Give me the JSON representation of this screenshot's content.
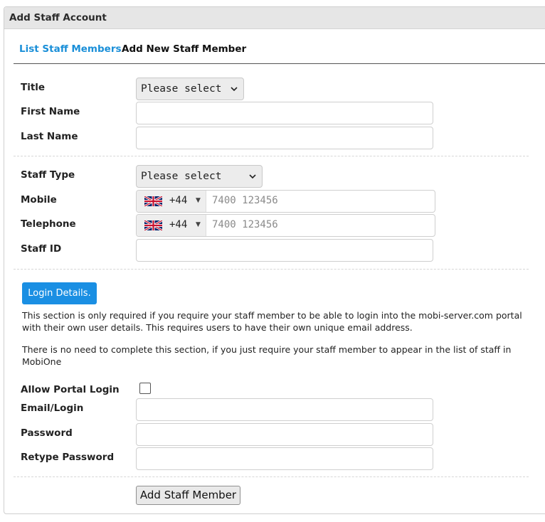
{
  "panel": {
    "title": "Add Staff Account"
  },
  "tabs": [
    {
      "label": "List Staff Members"
    },
    {
      "label": "Add New Staff Member"
    }
  ],
  "form": {
    "title_label": "Title",
    "title_select": "Please select",
    "first_name_label": "First Name",
    "first_name_value": "",
    "last_name_label": "Last Name",
    "last_name_value": "",
    "staff_type_label": "Staff Type",
    "staff_type_select": "Please select",
    "mobile_label": "Mobile",
    "mobile_country_code": "+44",
    "mobile_placeholder": "7400 123456",
    "telephone_label": "Telephone",
    "telephone_country_code": "+44",
    "telephone_placeholder": "7400 123456",
    "staff_id_label": "Staff ID",
    "staff_id_value": ""
  },
  "login": {
    "button_label": "Login Details.",
    "paragraph1": "This section is only required if you require your staff member to be able to login into the mobi-server.com portal with their own user details. This requires users to have their own unique email address.",
    "paragraph2": "There is no need to complete this section, if you just require your staff member to appear in the list of staff in MobiOne",
    "allow_portal_label": "Allow Portal Login",
    "allow_portal_checked": false,
    "email_label": "Email/Login",
    "password_label": "Password",
    "retype_password_label": "Retype Password"
  },
  "submit_label": "Add Staff Member",
  "icons": {
    "flag": "uk-flag-icon",
    "select_arrow": "chevron-down-icon",
    "dropdown_caret": "caret-down-icon"
  },
  "colors": {
    "link": "#1a8fd8",
    "primary_button": "#1a8fe3"
  }
}
